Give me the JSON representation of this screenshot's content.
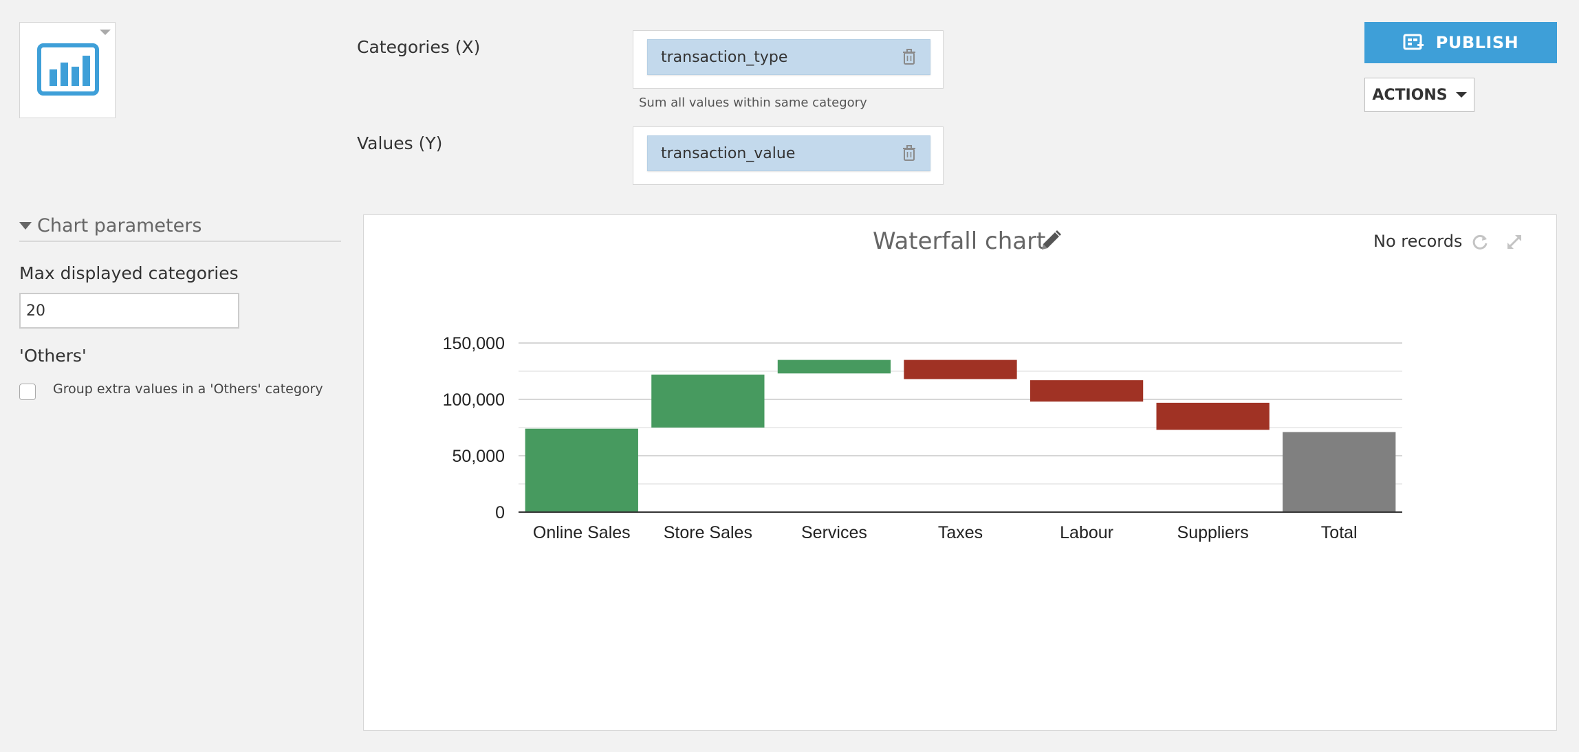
{
  "chart_type_icon": "bar-chart-icon",
  "fields": {
    "categories_label": "Categories (X)",
    "categories_value": "transaction_type",
    "categories_hint": "Sum all values within same category",
    "values_label": "Values (Y)",
    "values_value": "transaction_value"
  },
  "toolbar": {
    "publish_label": "PUBLISH",
    "actions_label": "ACTIONS"
  },
  "params": {
    "section_title": "Chart parameters",
    "max_categories_label": "Max displayed categories",
    "max_categories_value": "20",
    "others_label": "'Others'",
    "others_checkbox_label": "Group extra values in a 'Others' category",
    "others_checked": false
  },
  "chart_header": {
    "title": "Waterfall chart",
    "status": "No records"
  },
  "colors": {
    "increase": "#479a5f",
    "decrease": "#a03224",
    "total": "#808080",
    "accent": "#3e9fd8"
  },
  "chart_data": {
    "type": "bar",
    "subtype": "waterfall",
    "title": "Waterfall chart",
    "categories": [
      "Online Sales",
      "Store Sales",
      "Services",
      "Taxes",
      "Labour",
      "Suppliers",
      "Total"
    ],
    "bars": [
      {
        "category": "Online Sales",
        "start": 0,
        "end": 74000,
        "kind": "increase"
      },
      {
        "category": "Store Sales",
        "start": 75000,
        "end": 122000,
        "kind": "increase"
      },
      {
        "category": "Services",
        "start": 123000,
        "end": 135000,
        "kind": "increase"
      },
      {
        "category": "Taxes",
        "start": 135000,
        "end": 118000,
        "kind": "decrease"
      },
      {
        "category": "Labour",
        "start": 117000,
        "end": 98000,
        "kind": "decrease"
      },
      {
        "category": "Suppliers",
        "start": 97000,
        "end": 73000,
        "kind": "decrease"
      },
      {
        "category": "Total",
        "start": 0,
        "end": 71000,
        "kind": "total"
      }
    ],
    "yticks": [
      0,
      50000,
      100000,
      150000
    ],
    "ytick_labels": [
      "0",
      "50,000",
      "100,000",
      "150,000"
    ],
    "ylim": [
      0,
      150000
    ],
    "grid": true,
    "legend": "none"
  }
}
